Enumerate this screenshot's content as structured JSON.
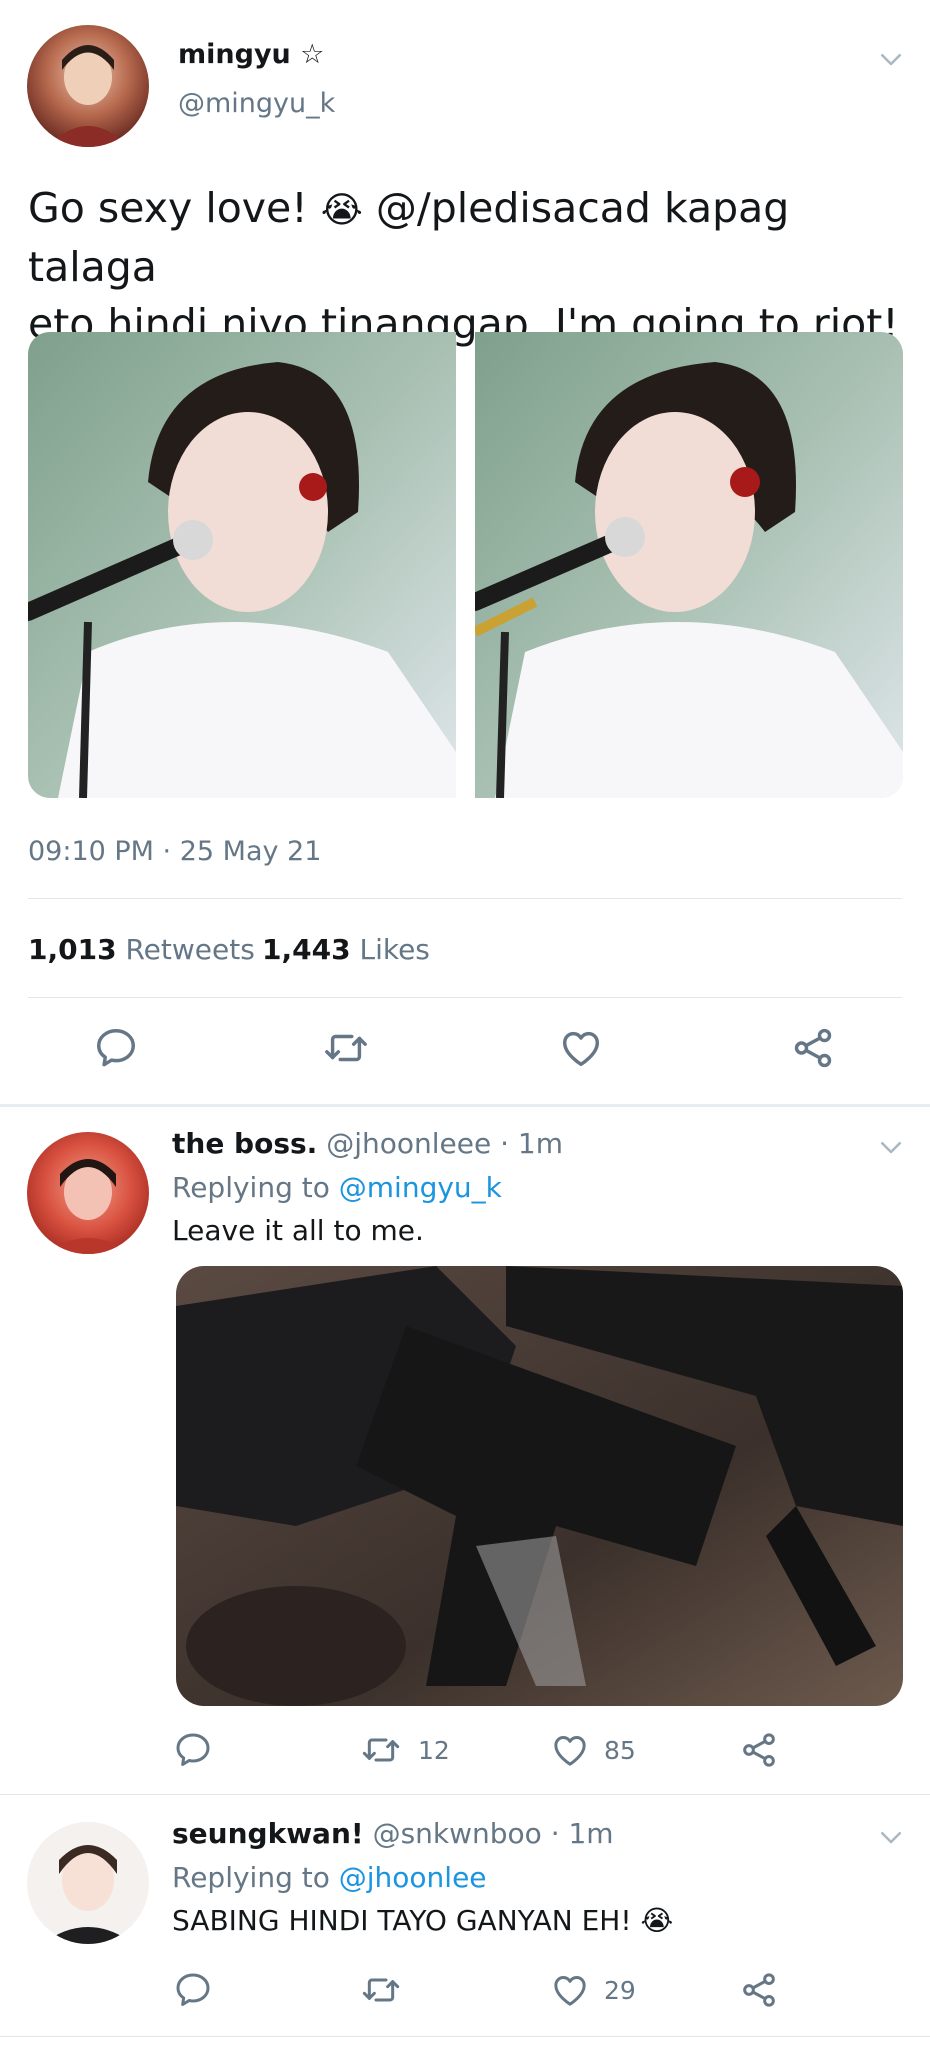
{
  "main_tweet": {
    "display_name": "mingyu",
    "star": "☆",
    "handle": "@mingyu_k",
    "text_line1_a": "Go sexy love!",
    "emoji": "😭",
    "text_line1_b": "@/pledisacad kapag talaga",
    "text_line2": "eto hindi niyo tinanggap, I'm going to riot!",
    "timestamp": "09:10 PM · 25 May 21",
    "retweets_count": "1,013",
    "retweets_label": "Retweets",
    "likes_count": "1,443",
    "likes_label": "Likes"
  },
  "replies": [
    {
      "display_name": "the boss.",
      "handle_time": "@jhoonleee · 1m",
      "replying_prefix": "Replying to",
      "replying_to": "@mingyu_k",
      "text": "Leave it all to me.",
      "retweet_count": "12",
      "like_count": "85"
    },
    {
      "display_name": "seungkwan!",
      "handle_time": "@snkwnboo · 1m",
      "replying_prefix": "Replying to",
      "replying_to": "@jhoonlee",
      "text": "SABING HINDI TAYO GANYAN EH!",
      "emoji": "😭",
      "like_count": "29"
    }
  ],
  "icons": [
    "reply-icon",
    "retweet-icon",
    "like-icon",
    "share-icon",
    "chevron-down-icon"
  ],
  "colors": {
    "link": "#1b95e0",
    "muted": "#657786",
    "divider": "#e1e8ed",
    "text": "#14171a"
  }
}
